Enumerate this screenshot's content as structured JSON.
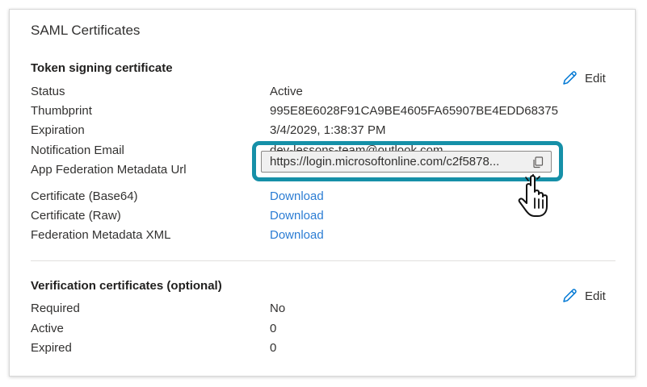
{
  "title": "SAML Certificates",
  "token": {
    "heading": "Token signing certificate",
    "edit_label": "Edit",
    "rows": [
      {
        "label": "Status",
        "value": "Active"
      },
      {
        "label": "Thumbprint",
        "value": "995E8E6028F91CA9BE4605FA65907BE4EDD68375"
      },
      {
        "label": "Expiration",
        "value": "3/4/2029, 1:38:37 PM"
      },
      {
        "label": "Notification Email",
        "value": "dev-lessons-team@outlook.com"
      },
      {
        "label": "App Federation Metadata Url",
        "value": "https://login.microsoftonline.com/c2f5878..."
      },
      {
        "label": "Certificate (Base64)",
        "value": "Download"
      },
      {
        "label": "Certificate (Raw)",
        "value": "Download"
      },
      {
        "label": "Federation Metadata XML",
        "value": "Download"
      }
    ]
  },
  "verification": {
    "heading": "Verification certificates (optional)",
    "edit_label": "Edit",
    "rows": [
      {
        "label": "Required",
        "value": "No"
      },
      {
        "label": "Active",
        "value": "0"
      },
      {
        "label": "Expired",
        "value": "0"
      }
    ]
  },
  "icons": {
    "edit": "pencil-icon",
    "copy": "copy-icon",
    "cursor": "hand-pointer-icon"
  },
  "colors": {
    "link": "#2b7cd3",
    "highlight": "#1690a8",
    "edit_icon": "#0078d4"
  }
}
